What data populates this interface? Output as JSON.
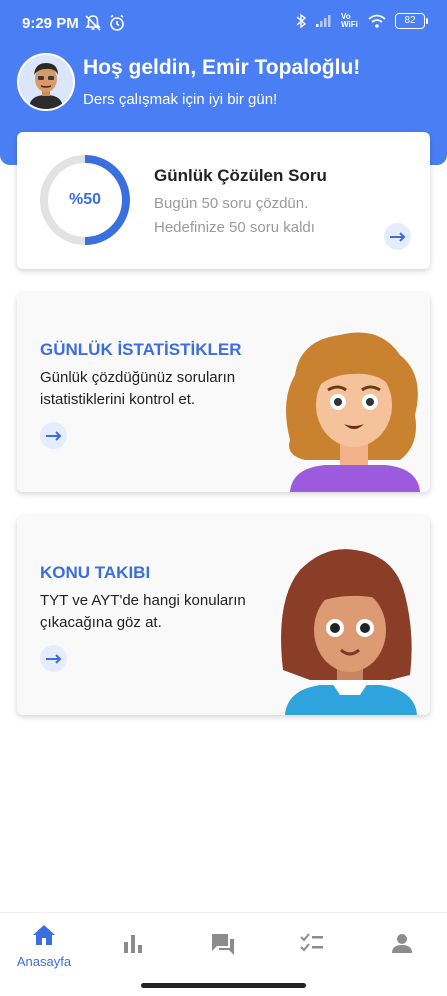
{
  "status_bar": {
    "time": "9:29 PM",
    "battery": "82",
    "network_label": "Vo WiFi"
  },
  "header": {
    "greeting": "Hoş geldin, Emir Topaloğlu!",
    "subtitle": "Ders çalışmak için iyi bir gün!",
    "avatar_icon": "user-avatar"
  },
  "daily_card": {
    "progress_label": "%50",
    "progress_fraction": 0.5,
    "title": "Günlük Çözülen Soru",
    "line1": "Bugün 50 soru çözdün.",
    "line2": "Hedefinize 50 soru kaldı"
  },
  "stats_card": {
    "title": "GÜNLÜK İSTATİSTİKLER",
    "description": "Günlük çözdüğünüz soruların istatistiklerini kontrol et."
  },
  "topics_card": {
    "title": "KONU TAKIBI",
    "description": "TYT ve AYT'de hangi konuların çıkacağına göz at."
  },
  "bottom_nav": {
    "items": [
      {
        "label": "Anasayfa",
        "icon": "home-icon",
        "active": true
      },
      {
        "label": "",
        "icon": "bar-chart-icon",
        "active": false
      },
      {
        "label": "",
        "icon": "chat-icon",
        "active": false
      },
      {
        "label": "",
        "icon": "checklist-icon",
        "active": false
      },
      {
        "label": "",
        "icon": "profile-icon",
        "active": false
      }
    ]
  },
  "colors": {
    "accent": "#4a7ef5",
    "accent_text": "#3b6fe0",
    "muted": "#9a9a9a",
    "inactive_icon": "#8c8c8c"
  }
}
